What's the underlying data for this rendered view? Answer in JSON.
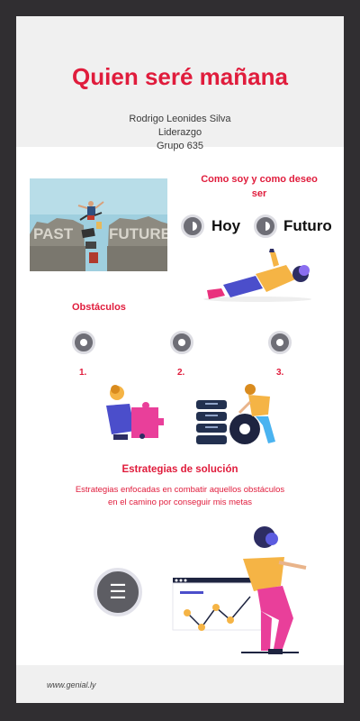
{
  "header": {
    "title": "Quien seré mañana",
    "author": "Rodrigo Leonides Silva",
    "subject": "Liderazgo",
    "group": "Grupo 635"
  },
  "photo": {
    "word_left": "PAST",
    "word_right": "FUTURE"
  },
  "compare": {
    "heading_line1": "Como soy y como deseo",
    "heading_line2": "ser",
    "today": "Hoy",
    "future": "Futuro"
  },
  "obstacles": {
    "heading": "Obstáculos",
    "items": [
      "1.",
      "2.",
      "3."
    ]
  },
  "strategies": {
    "heading": "Estrategias de solución",
    "text_line1": "Estrategias enfocadas en combatir aquellos obstáculos",
    "text_line2": "en el camino por conseguir mis metas"
  },
  "menu_button": {
    "icon": "hamburger-icon"
  },
  "footer": {
    "text": "www.genial.ly"
  },
  "colors": {
    "accent": "#e01c3c",
    "background": "#302e31",
    "band": "#f0f0f0",
    "button": "#5d5d63"
  }
}
